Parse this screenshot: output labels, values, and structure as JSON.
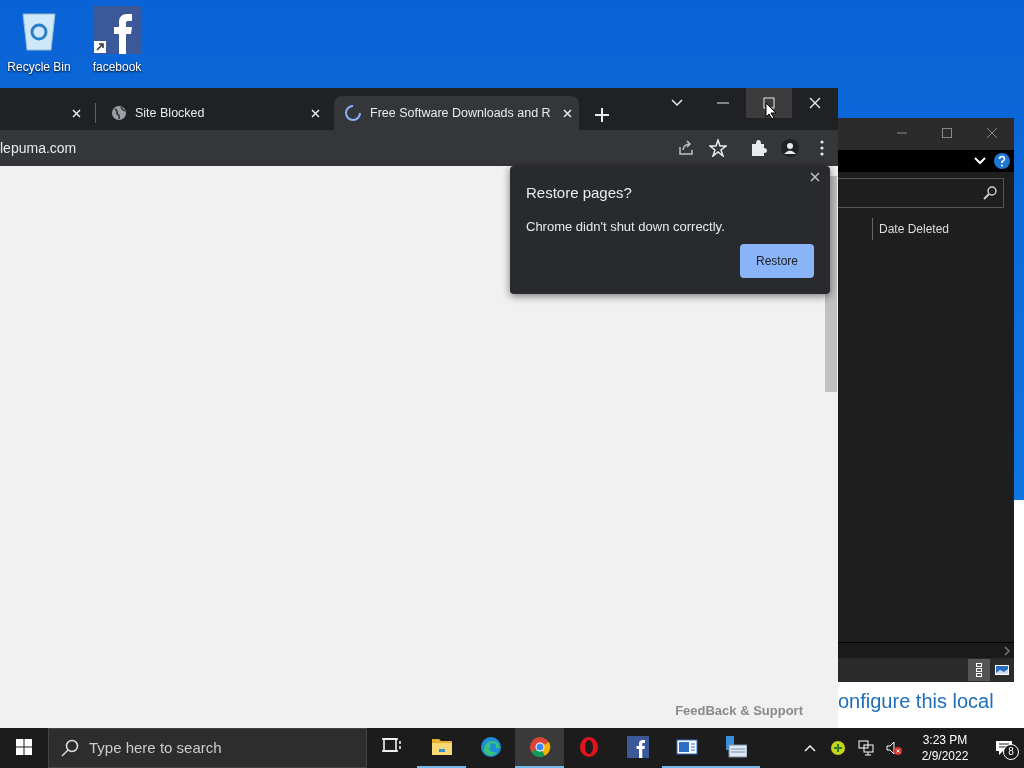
{
  "desktop_icons": [
    {
      "kind": "recycle",
      "label": "Recycle Bin"
    },
    {
      "kind": "facebook",
      "label": "facebook"
    }
  ],
  "browser": {
    "tabs": [
      {
        "kind": "partial",
        "selected": false
      },
      {
        "kind": "globe",
        "title": "Site Blocked",
        "selected": false
      },
      {
        "kind": "loading",
        "title": "Free Software Downloads and R",
        "selected": true
      }
    ],
    "address": "lepuma.com",
    "popup": {
      "title": "Restore pages?",
      "message": "Chrome didn't shut down correctly.",
      "button": "Restore"
    },
    "page_footer": "FeedBack & Support"
  },
  "explorer": {
    "columns": [
      "Date Deleted"
    ]
  },
  "back_window": {
    "heading": "onfigure this local"
  },
  "taskbar": {
    "search": {
      "placeholder": "Type here to search"
    },
    "apps": [
      {
        "kind": "taskview",
        "running": false,
        "selected": false
      },
      {
        "kind": "folder",
        "running": true,
        "selected": false
      },
      {
        "kind": "edge",
        "running": false,
        "selected": false
      },
      {
        "kind": "chrome",
        "running": true,
        "selected": true
      },
      {
        "kind": "opera",
        "running": false,
        "selected": false
      },
      {
        "kind": "facebook",
        "running": false,
        "selected": false
      },
      {
        "kind": "window",
        "running": true,
        "selected": false
      },
      {
        "kind": "computer",
        "running": true,
        "selected": false
      }
    ],
    "time": "3:23 PM",
    "date": "2/9/2022",
    "notifications": "8"
  }
}
